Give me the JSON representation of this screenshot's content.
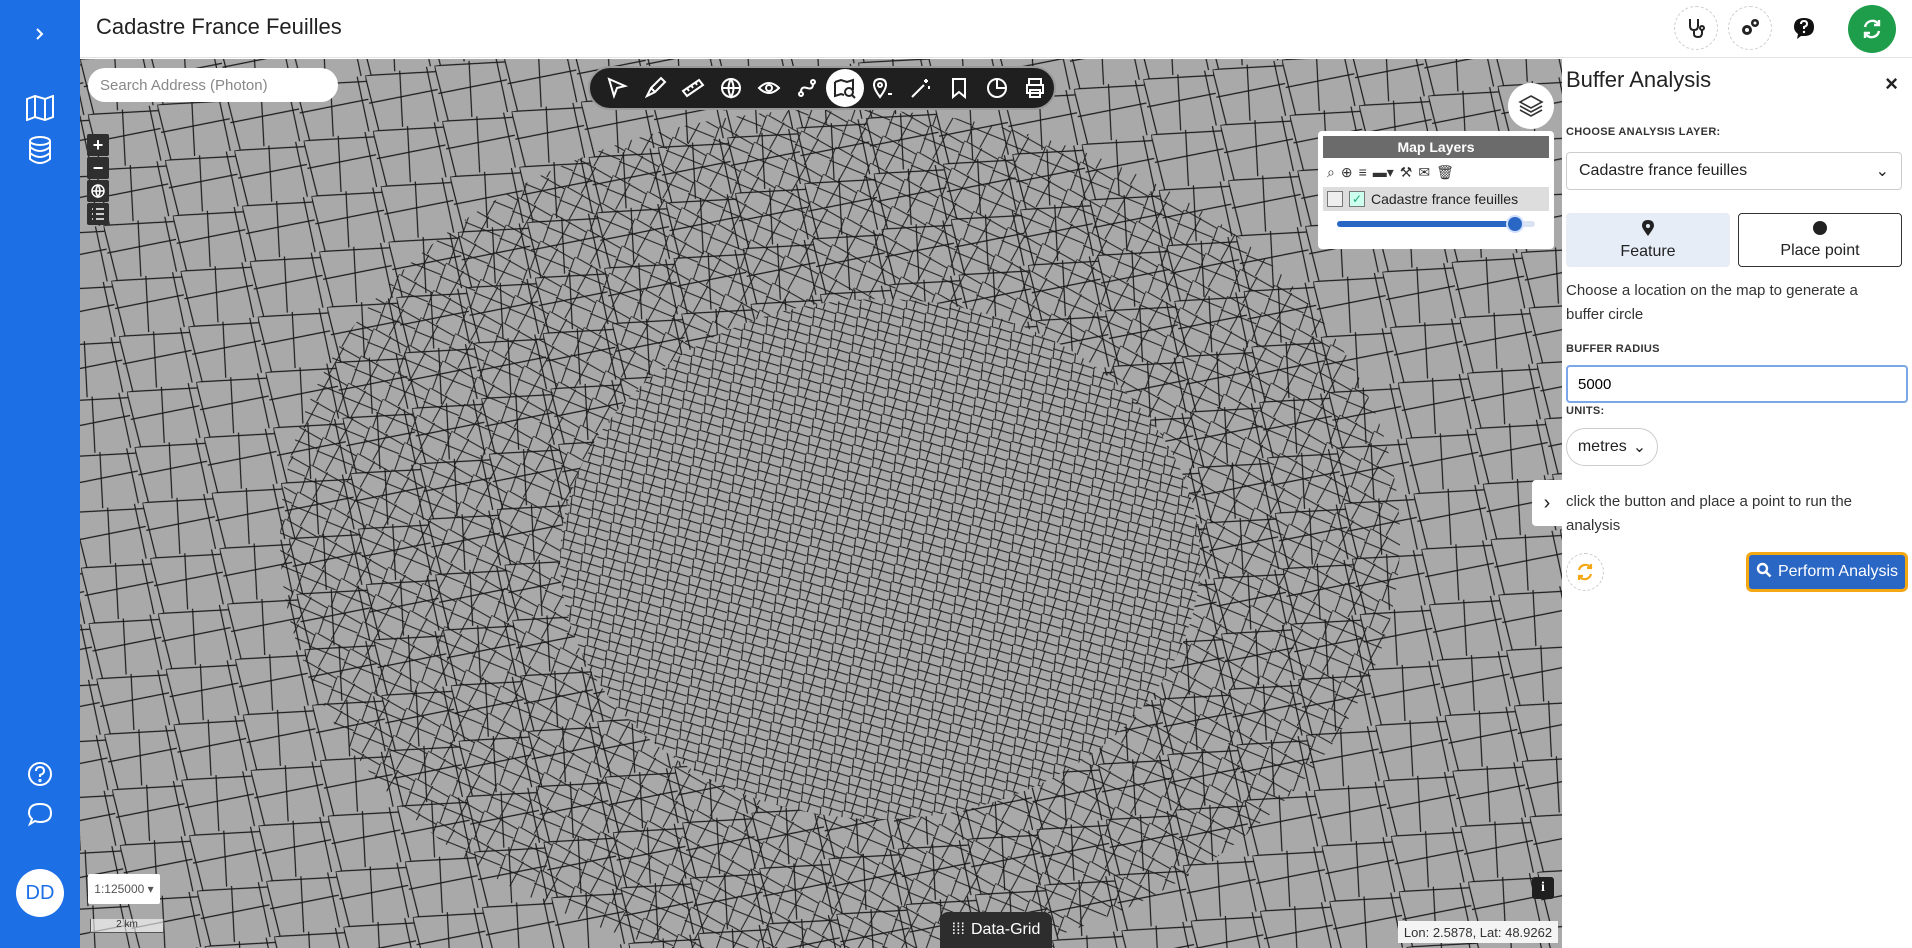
{
  "app": {
    "title": "Cadastre France Feuilles",
    "user_initials": "DD"
  },
  "rail": {
    "items": [
      "expand-icon",
      "map-icon",
      "database-icon",
      "help-icon",
      "chat-icon"
    ]
  },
  "header": {
    "buttons": [
      "stethoscope-icon",
      "gears-icon",
      "question-icon",
      "refresh-icon"
    ]
  },
  "map": {
    "search_placeholder": "Search Address (Photon)",
    "toolbar_tools": [
      "select-icon",
      "draw-icon",
      "measure-icon",
      "globe-icon",
      "eye-icon",
      "route-icon",
      "search-map-icon",
      "location-icon",
      "magic-icon",
      "bookmark-icon",
      "pie-chart-icon",
      "print-icon"
    ],
    "active_tool": "search-map-icon",
    "layers_panel": {
      "title": "Map Layers",
      "layer_name": "Cadastre france feuilles",
      "opacity": 0.9
    },
    "scale": "1:125000",
    "scale_bar": "2 km",
    "data_grid_label": "Data-Grid",
    "coords": "Lon: 2.5878, Lat: 48.9262",
    "info_label": "i"
  },
  "panel": {
    "title": "Buffer Analysis",
    "choose_layer_label": "CHOOSE ANALYSIS LAYER:",
    "selected_layer": "Cadastre france feuilles",
    "feature_label": "Feature",
    "place_point_label": "Place point",
    "instruction": "Choose a location on the map to generate a buffer circle",
    "buffer_radius_label": "BUFFER RADIUS",
    "buffer_radius_value": "5000",
    "units_label": "UNITS:",
    "units_value": "metres",
    "run_instruction": "click the button and place a point to run the analysis",
    "perform_label": "Perform Analysis"
  },
  "colors": {
    "brand": "#1d6fe6",
    "accent": "#2a66c4",
    "focus": "#f4a814",
    "map_bg": "#a9a9a9"
  }
}
